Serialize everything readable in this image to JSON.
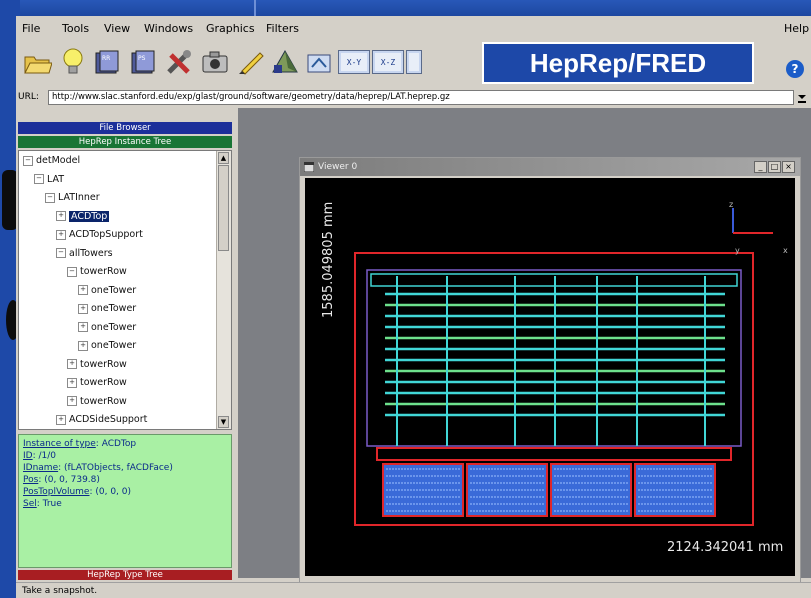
{
  "menu": {
    "file": "File",
    "tools": "Tools",
    "view": "View",
    "windows": "Windows",
    "graphics": "Graphics",
    "filters": "Filters",
    "help": "Help"
  },
  "toolbar": {
    "view_xy": "X-Y",
    "view_xz": "X-Z",
    "banner": "HepRep/FRED",
    "help_icon": "?"
  },
  "url": {
    "label": "URL:",
    "value": "http://www.slac.stanford.edu/exp/glast/ground/software/geometry/data/heprep/LAT.heprep.gz"
  },
  "panels": {
    "file_browser": "File Browser",
    "instance_tree": "HepRep Instance Tree",
    "type_tree": "HepRep Type Tree"
  },
  "tree": [
    {
      "label": "detModel",
      "depth": 0,
      "exp": "−",
      "selected": false
    },
    {
      "label": "LAT",
      "depth": 1,
      "exp": "−",
      "selected": false
    },
    {
      "label": "LATInner",
      "depth": 2,
      "exp": "−",
      "selected": false
    },
    {
      "label": "ACDTop",
      "depth": 3,
      "exp": "+",
      "selected": true
    },
    {
      "label": "ACDTopSupport",
      "depth": 3,
      "exp": "+",
      "selected": false
    },
    {
      "label": "allTowers",
      "depth": 3,
      "exp": "−",
      "selected": false
    },
    {
      "label": "towerRow",
      "depth": 4,
      "exp": "−",
      "selected": false
    },
    {
      "label": "oneTower",
      "depth": 5,
      "exp": "+",
      "selected": false
    },
    {
      "label": "oneTower",
      "depth": 5,
      "exp": "+",
      "selected": false
    },
    {
      "label": "oneTower",
      "depth": 5,
      "exp": "+",
      "selected": false
    },
    {
      "label": "oneTower",
      "depth": 5,
      "exp": "+",
      "selected": false
    },
    {
      "label": "towerRow",
      "depth": 4,
      "exp": "+",
      "selected": false
    },
    {
      "label": "towerRow",
      "depth": 4,
      "exp": "+",
      "selected": false
    },
    {
      "label": "towerRow",
      "depth": 4,
      "exp": "+",
      "selected": false
    },
    {
      "label": "ACDSideSupport",
      "depth": 3,
      "exp": "+",
      "selected": false
    }
  ],
  "properties": [
    {
      "key": "Instance of type",
      "value": "ACDTop"
    },
    {
      "key": "ID",
      "value": "/1/0"
    },
    {
      "key": "IDname",
      "value": "(fLATObjects, fACDFace)"
    },
    {
      "key": "Pos",
      "value": "(0, 0, 739.8)"
    },
    {
      "key": "PosToplVolume",
      "value": "(0, 0, 0)"
    },
    {
      "key": "Sel",
      "value": "True"
    }
  ],
  "viewer": {
    "title": "Viewer 0",
    "scale_vertical": "1585.049805 mm",
    "scale_horizontal": "2124.342041 mm",
    "axis_z": "z",
    "axis_y": "y",
    "axis_x": "x"
  },
  "status": "Take a snapshot.",
  "colors": {
    "frame_red": "#e0262a",
    "structure_cyan": "#41d6d6",
    "panel_purple": "#7a5cc8",
    "tracker_green": "#6de08c",
    "calorimeter_blue": "#3a6ad8",
    "properties_bg": "#a9f0a4"
  },
  "icons": [
    "open-folder-icon",
    "lightbulb-icon",
    "book-icon",
    "book-icon",
    "tools-icon",
    "camera-icon",
    "pencil-icon",
    "pyramid-icon",
    "3d-view-icon",
    "x-y-view-icon",
    "x-z-view-icon",
    "help-icon"
  ]
}
